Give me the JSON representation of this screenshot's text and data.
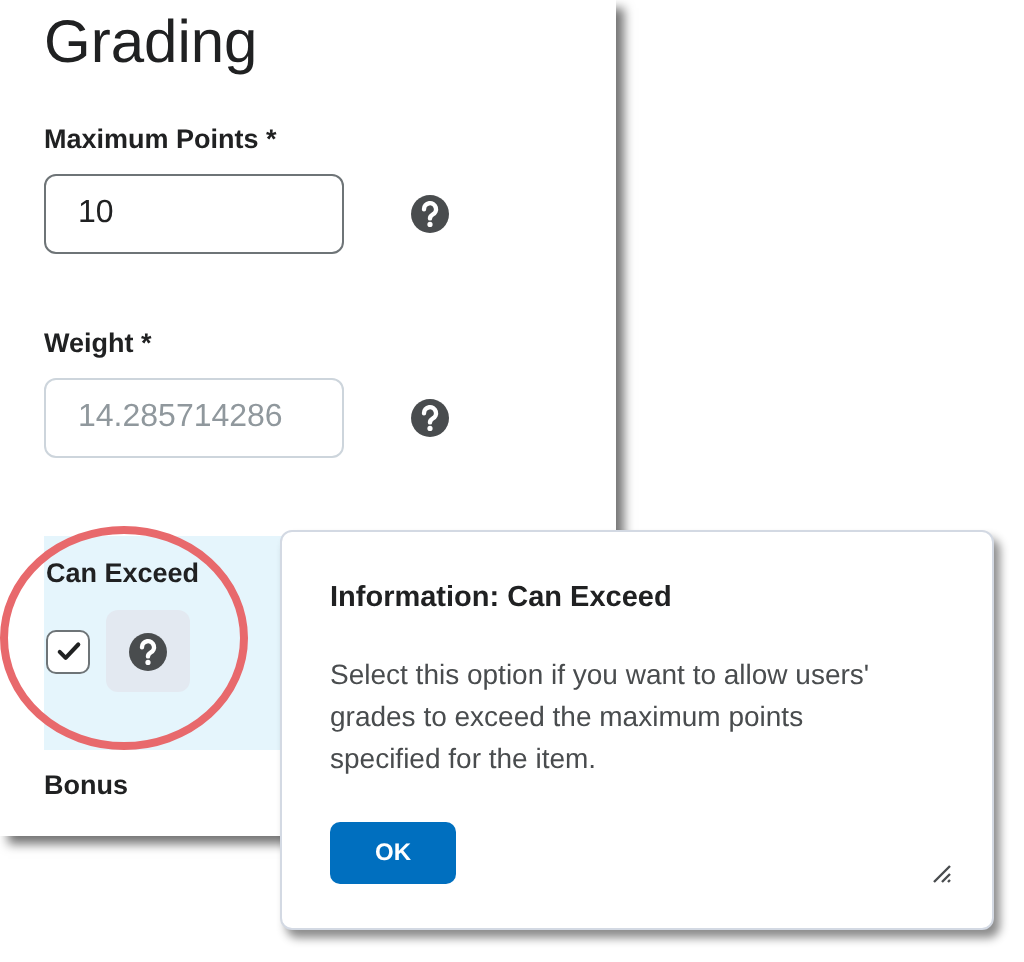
{
  "panel": {
    "title": "Grading",
    "fields": [
      {
        "label": "Maximum Points *",
        "value": "10",
        "disabled": false
      },
      {
        "label": "Weight *",
        "value": "14.285714286",
        "disabled": true
      }
    ],
    "can_exceed": {
      "label": "Can Exceed",
      "checked": true
    },
    "bonus": {
      "label": "Bonus"
    }
  },
  "dialog": {
    "title": "Information: Can Exceed",
    "text": "Select this option if you want to allow users' grades to exceed the maximum points specified for the item.",
    "buttons": [
      "OK"
    ]
  }
}
